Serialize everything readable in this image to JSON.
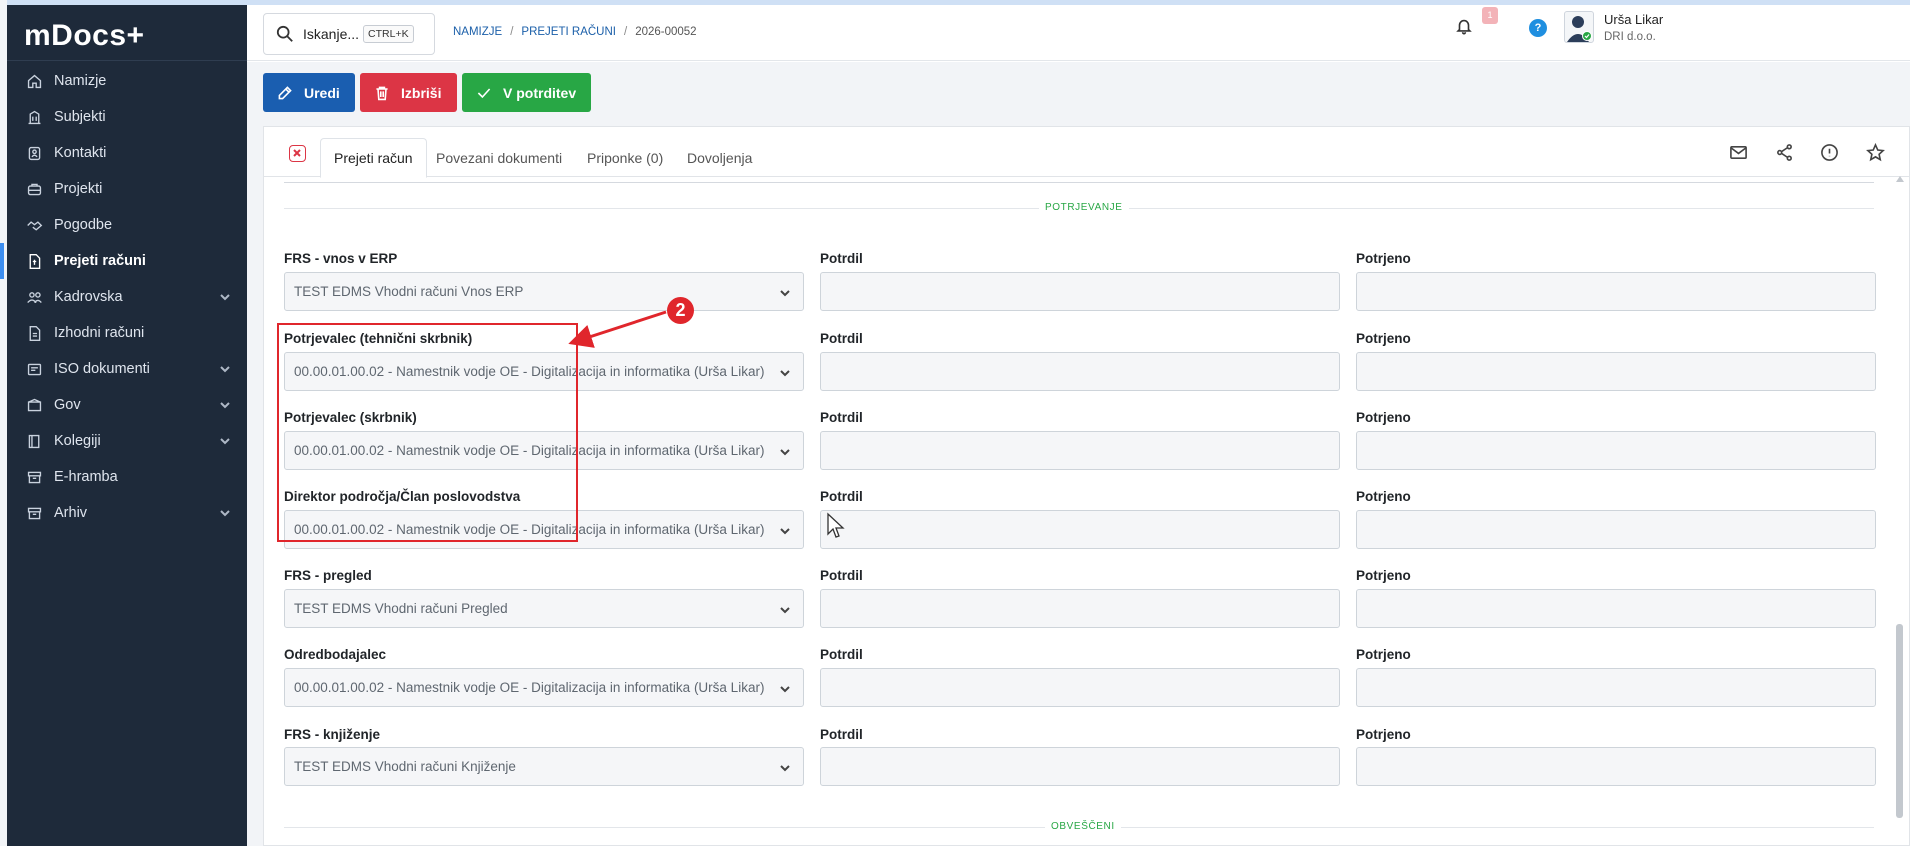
{
  "app": {
    "logo": "mDocs+"
  },
  "sidebar": {
    "items": [
      {
        "label": "Namizje",
        "icon": "home-icon"
      },
      {
        "label": "Subjekti",
        "icon": "building-icon"
      },
      {
        "label": "Kontakti",
        "icon": "contact-card-icon"
      },
      {
        "label": "Projekti",
        "icon": "briefcase-icon"
      },
      {
        "label": "Pogodbe",
        "icon": "handshake-icon"
      },
      {
        "label": "Prejeti računi",
        "icon": "invoice-icon",
        "active": true
      },
      {
        "label": "Kadrovska",
        "icon": "people-icon",
        "expandable": true
      },
      {
        "label": "Izhodni računi",
        "icon": "document-icon"
      },
      {
        "label": "ISO dokumenti",
        "icon": "iso-document-icon",
        "expandable": true
      },
      {
        "label": "Gov",
        "icon": "gov-icon",
        "expandable": true
      },
      {
        "label": "Kolegiji",
        "icon": "book-icon",
        "expandable": true
      },
      {
        "label": "E-hramba",
        "icon": "archive-icon"
      },
      {
        "label": "Arhiv",
        "icon": "archive-box-icon",
        "expandable": true
      }
    ]
  },
  "header": {
    "search_label": "Iskanje...",
    "search_shortcut": "CTRL+K",
    "breadcrumb": [
      "NAMIZJE",
      "PREJETI RAČUNI",
      "2026-00052"
    ],
    "notification_count": "1",
    "help_label": "?",
    "user_name": "Urša Likar",
    "user_org": "DRI d.o.o."
  },
  "toolbar": {
    "edit_label": "Uredi",
    "delete_label": "Izbriši",
    "confirm_label": "V potrditev"
  },
  "tabs": {
    "items": [
      "Prejeti račun",
      "Povezani dokumenti",
      "Priponke (0)",
      "Dovoljenja"
    ],
    "active": "Prejeti račun"
  },
  "form": {
    "section_title": "POTRJEVANJE",
    "section_next": "OBVEŠČENI",
    "col_potrdil": "Potrdil",
    "col_potrjeno": "Potrjeno",
    "rows": [
      {
        "label": "FRS - vnos v ERP",
        "value": "TEST EDMS Vhodni računi Vnos ERP"
      },
      {
        "label": "Potrjevalec (tehnični skrbnik)",
        "value": "00.00.01.00.02 - Namestnik vodje OE - Digitalizacija in informatika (Urša Likar)"
      },
      {
        "label": "Potrjevalec (skrbnik)",
        "value": "00.00.01.00.02 - Namestnik vodje OE - Digitalizacija in informatika (Urša Likar)"
      },
      {
        "label": "Direktor področja/Član poslovodstva",
        "value": "00.00.01.00.02 - Namestnik vodje OE - Digitalizacija in informatika (Urša Likar)"
      },
      {
        "label": "FRS - pregled",
        "value": "TEST EDMS Vhodni računi Pregled"
      },
      {
        "label": "Odredbodajalec",
        "value": "00.00.01.00.02 - Namestnik vodje OE - Digitalizacija in informatika (Urša Likar)"
      },
      {
        "label": "FRS - knjiženje",
        "value": "TEST EDMS Vhodni računi Knjiženje"
      }
    ]
  },
  "annotation": {
    "step_number": "2",
    "color": "#e0262c"
  },
  "colors": {
    "primary": "#1a5eb0",
    "danger": "#dc3545",
    "success": "#28a745",
    "sidebar": "#1e2a3a"
  }
}
